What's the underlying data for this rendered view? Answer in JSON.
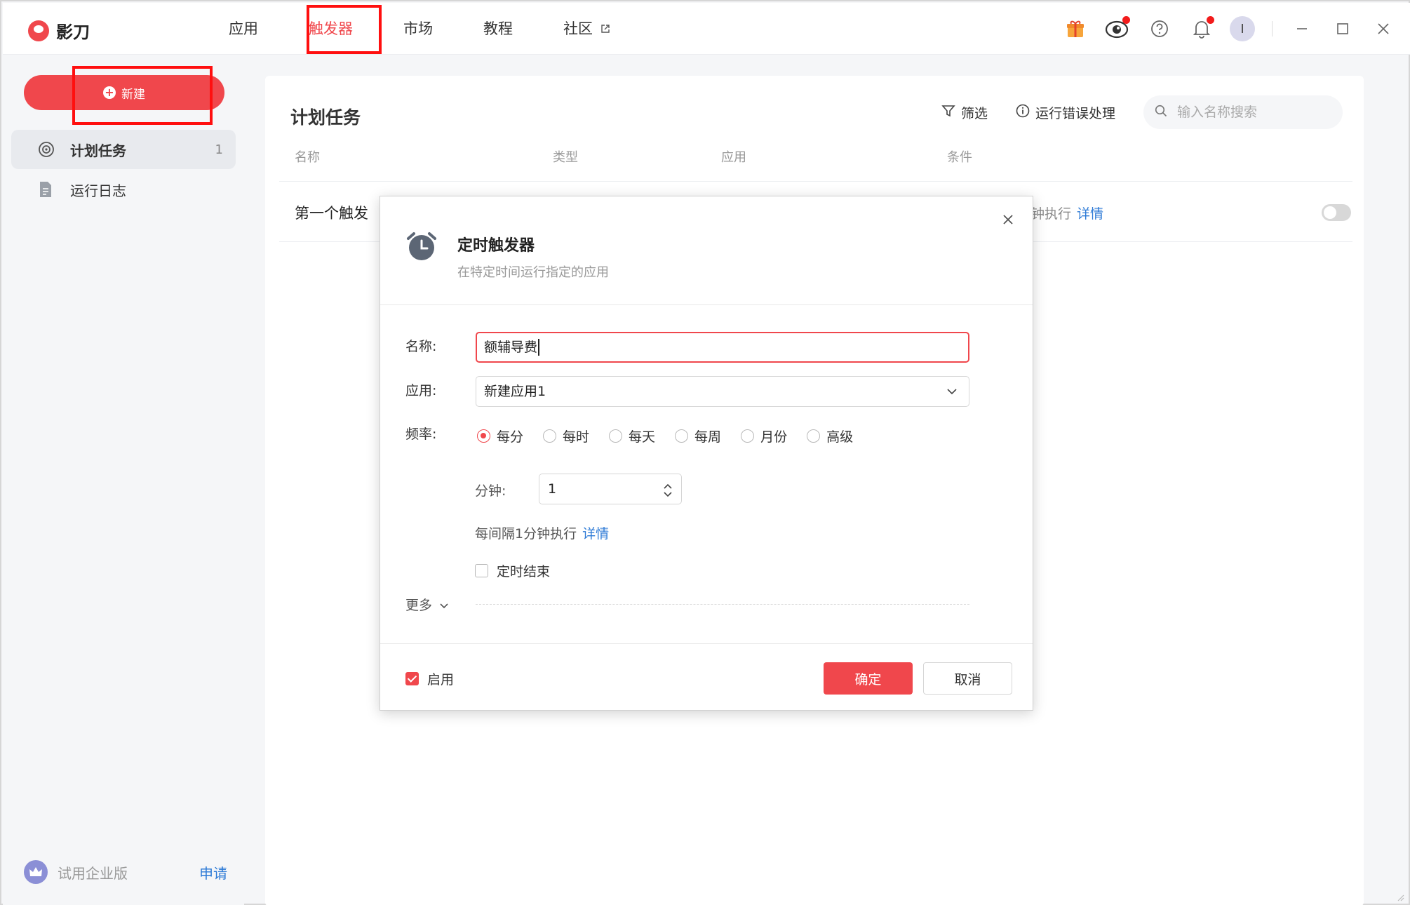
{
  "app": {
    "name": "影刀"
  },
  "nav": {
    "items": [
      {
        "label": "应用"
      },
      {
        "label": "触发器",
        "active": true
      },
      {
        "label": "市场"
      },
      {
        "label": "教程"
      },
      {
        "label": "社区",
        "external": true
      }
    ]
  },
  "topbar_icons": [
    "gift-icon",
    "eye-mascot-icon",
    "help-icon",
    "bell-icon",
    "avatar",
    "minimize-icon",
    "maximize-icon",
    "close-icon"
  ],
  "user": {
    "avatar_initial": "I"
  },
  "sidebar": {
    "new_button": "新建",
    "items": [
      {
        "label": "计划任务",
        "count": "1",
        "icon": "radar-icon",
        "active": true
      },
      {
        "label": "运行日志",
        "icon": "document-icon"
      }
    ],
    "trial": {
      "label": "试用企业版",
      "link": "申请"
    }
  },
  "main": {
    "title": "计划任务",
    "filter_label": "筛选",
    "error_handling_label": "运行错误处理",
    "search_placeholder": "输入名称搜索",
    "columns": [
      "名称",
      "类型",
      "应用",
      "条件"
    ],
    "rows": [
      {
        "name": "第一个触发",
        "condition": "钟执行",
        "condition_link": "详情",
        "enabled": false
      }
    ]
  },
  "modal": {
    "title": "定时触发器",
    "subtitle": "在特定时间运行指定的应用",
    "name_label": "名称:",
    "name_value": "额辅导费",
    "app_label": "应用:",
    "app_value": "新建应用1",
    "freq_label": "频率:",
    "freq_options": [
      "每分",
      "每时",
      "每天",
      "每周",
      "月份",
      "高级"
    ],
    "freq_selected": "每分",
    "minute_label": "分钟:",
    "minute_value": "1",
    "interval_desc": "每间隔1分钟执行",
    "interval_link": "详情",
    "timed_end_label": "定时结束",
    "more_label": "更多",
    "enable_label": "启用",
    "ok_label": "确定",
    "cancel_label": "取消"
  },
  "colors": {
    "accent": "#f0474c",
    "link": "#2d7ad6",
    "highlight_box": "#ff0f0f"
  }
}
